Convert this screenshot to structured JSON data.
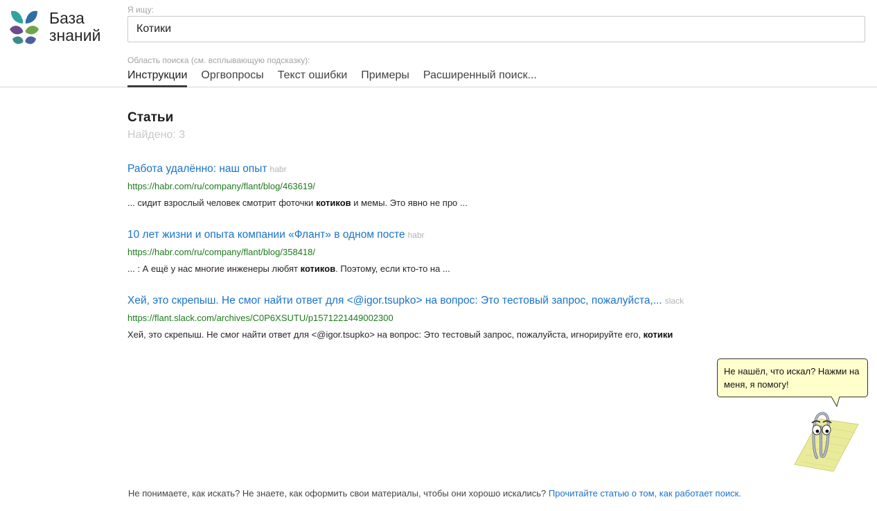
{
  "brand": {
    "line1": "База",
    "line2": "знаний"
  },
  "search": {
    "label": "Я ищу:",
    "value": "Котики"
  },
  "area": {
    "label": "Область поиска (см. всплывающую подсказку):",
    "tabs": [
      "Инструкции",
      "Оргвопросы",
      "Текст ошибки",
      "Примеры",
      "Расширенный поиск..."
    ],
    "active_tab": "Инструкции"
  },
  "results_section": {
    "title": "Статьи",
    "found": "Найдено: 3"
  },
  "results": [
    {
      "title": "Работа удалённо: наш опыт",
      "source": "habr",
      "url": "https://habr.com/ru/company/flant/blog/463619/",
      "snippet_before": "... сидит взрослый человек смотрит фоточки ",
      "snippet_bold": "котиков",
      "snippet_after": " и мемы. Это явно не про ..."
    },
    {
      "title": "10 лет жизни и опыта компании «Флант» в одном посте",
      "source": "habr",
      "url": "https://habr.com/ru/company/flant/blog/358418/",
      "snippet_before": "... : А ещё у нас многие инженеры любят ",
      "snippet_bold": "котиков",
      "snippet_after": ". Поэтому, если кто-то на ..."
    },
    {
      "title": "Хей, это скрепыш. Не смог найти ответ для <@igor.tsupko> на вопрос: Это тестовый запрос, пожалуйста,...",
      "source": "slack",
      "url": "https://flant.slack.com/archives/C0P6XSUTU/p1571221449002300",
      "snippet_before": "Хей, это скрепыш. Не смог найти ответ для <@igor.tsupko> на вопрос: Это тестовый запрос, пожалуйста, игнорируйте его, ",
      "snippet_bold": "котики",
      "snippet_after": ""
    }
  ],
  "assistant": {
    "bubble_text": "Не нашёл, что искал? Нажми на меня, я помогу!"
  },
  "footer": {
    "text": "Не понимаете, как искать? Не знаете, как оформить свои материалы, чтобы они хорошо искались?",
    "link": "Прочитайте статью о том, как работает поиск."
  },
  "colors": {
    "link": "#1a73c8",
    "url": "#1d7a1d",
    "muted": "#a3a3a3",
    "bubble": "#ffffcc",
    "logo_teal": "#2fa3a0",
    "logo_purple": "#6a4c8c",
    "logo_green": "#6ea54a",
    "logo_blue": "#2e6da8"
  },
  "icons": {
    "logo": "tree-logo-icon",
    "assistant": "paperclip-assistant-icon"
  }
}
